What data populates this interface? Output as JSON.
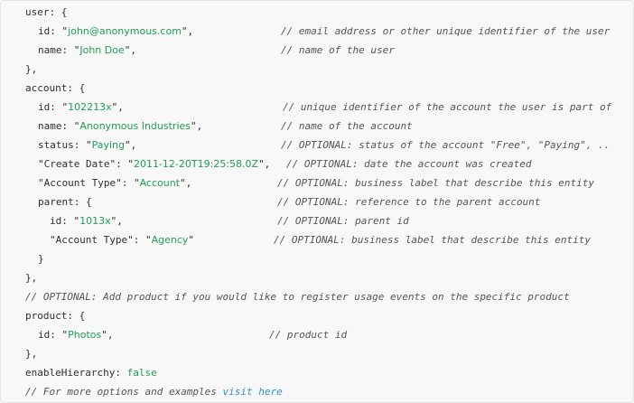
{
  "code": {
    "user_open": "user: {",
    "user_id_key": "id: \"",
    "user_id_value": "john@anonymous.com",
    "user_id_close": "\",",
    "user_id_comment": "// email address or other unique identifier of the user",
    "user_name_key": "name: \"",
    "user_name_value": "John Doe",
    "user_name_close": "\",",
    "user_name_comment": "// name of the user",
    "user_close": "},",
    "account_open": "account: {",
    "account_id_key": "id: \"",
    "account_id_value": "102213x",
    "account_id_close": "\",",
    "account_id_comment": "// unique identifier of the account the user is part of",
    "account_name_key": "name: \"",
    "account_name_value": "Anonymous Industries",
    "account_name_close": "\",",
    "account_name_comment": "// name of the account",
    "status_key": "status: \"",
    "status_value": "Paying",
    "status_close": "\",",
    "status_comment": "// OPTIONAL: status of the account \"Free\", \"Paying\", ..",
    "create_date_key": "\"Create Date\": \"",
    "create_date_value": "2011-12-20T19:25:58.0Z",
    "create_date_close": "\",",
    "create_date_comment": "// OPTIONAL: date the account was created",
    "account_type_key": "\"Account Type\": \"",
    "account_type_value": "Account",
    "account_type_close": "\",",
    "account_type_comment": "// OPTIONAL: business label that describe this entity",
    "parent_open": "parent: {",
    "parent_comment": "// OPTIONAL: reference to the parent account",
    "parent_id_key": "id: \"",
    "parent_id_value": "1013x",
    "parent_id_close": "\",",
    "parent_id_comment": "// OPTIONAL: parent id",
    "parent_type_key": "\"Account Type\": \"",
    "parent_type_value": "Agency",
    "parent_type_close": "\"",
    "parent_type_comment": "// OPTIONAL: business label that describe this entity",
    "parent_close": "}",
    "account_close": "},",
    "product_comment": "// OPTIONAL: Add product if you would like to register usage events on the specific product",
    "product_open": "product: {",
    "product_id_key": "id: \"",
    "product_id_value": "Photos",
    "product_id_close": "\",",
    "product_id_comment": "// product id",
    "product_close": "},",
    "hierarchy_key": "enableHierarchy: ",
    "hierarchy_value": "false",
    "footer_comment": "// For more options and examples ",
    "footer_link": "visit here"
  },
  "colors": {
    "string": "#1e9e53",
    "comment": "#555555",
    "link": "#2b8fd8",
    "text": "#2f2f2f",
    "background": "#f8f8f8"
  }
}
